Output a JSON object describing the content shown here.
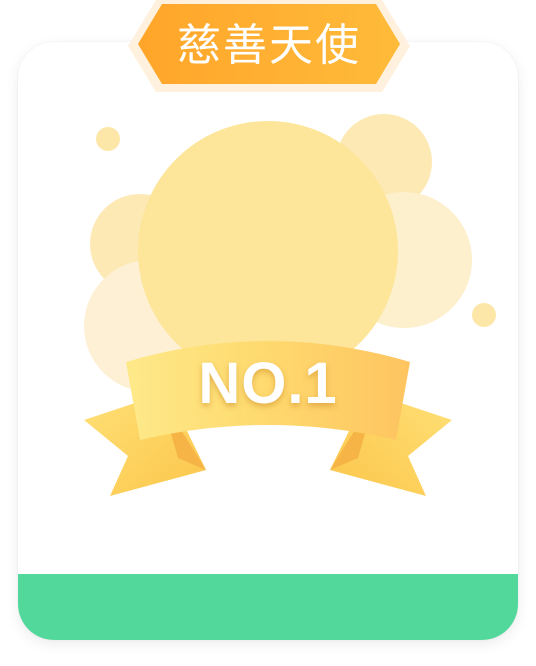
{
  "badge": {
    "title": "慈善天使"
  },
  "rank": {
    "label": "NO.1"
  },
  "colors": {
    "badge_orange": "#ffab2e",
    "badge_border": "#fff0dc",
    "medal_yellow": "#fde59a",
    "bubble_light": "#fdebb8",
    "ribbon_yellow": "#fdd35c",
    "footer_green": "#52d89a"
  }
}
